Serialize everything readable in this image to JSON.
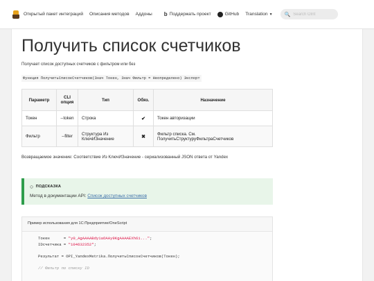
{
  "nav": {
    "items": [
      "Открытый пакет интеграций",
      "Описания методов",
      "Аддоны"
    ],
    "support_label": "Поддержать проект",
    "github_label": "GitHub",
    "translation_label": "Translation",
    "search_placeholder": "Search OInt"
  },
  "page": {
    "title": "Получить список счетчиков",
    "description": "Получает список доступных счетчиков с фильтром или без",
    "signature": "Функция ПолучитьСписокСчетчиков(Знач Токен, Знач Фильтр = Неопределено) Экспорт",
    "return_value": "Возвращаемое значение: Соответствие Из КлючИЗначение - сериализованный JSON ответа от Yandex"
  },
  "params_table": {
    "headers": [
      "Параметр",
      "CLI опция",
      "Тип",
      "Обяз.",
      "Назначение"
    ],
    "rows": [
      {
        "name": "Токен",
        "cli": "--token",
        "type": "Строка",
        "required": "✔",
        "purpose": "Токен авторизации"
      },
      {
        "name": "Фильтр",
        "cli": "--filter",
        "type": "Структура Из КлючИЗначение",
        "required": "✖",
        "purpose": "Фильтр списка. См. ПолучитьСтруктуруФильтраСчетчиков"
      }
    ]
  },
  "tip": {
    "heading": "ПОДСКАЗКА",
    "text_prefix": "Метод в документации API: ",
    "link_text": "Список доступных счетчиков"
  },
  "code": {
    "title": "Пример использования для 1С:Предприятие/OneScript",
    "lines": [
      {
        "plain": "Токен      = ",
        "str": "\"y0_AgAAAABdy1aOAAy9KgAAAAEXh6i...\"",
        "end": ";"
      },
      {
        "plain": "IDсчетчика = ",
        "str": "\"104632352\"",
        "end": ";"
      },
      {
        "plain": "",
        "str": "",
        "end": ""
      },
      {
        "plain": "Результат = OPI_YandexMetrika.ПолучитьСписокСчетчиков(Токен);",
        "str": "",
        "end": ""
      },
      {
        "plain": "",
        "str": "",
        "end": ""
      },
      {
        "comment": "// Фильтр по списку ID"
      }
    ]
  },
  "colors": {
    "accent_green": "#2e9d4b",
    "tip_bg": "#e8f5e9",
    "link": "#3b6fa8"
  }
}
